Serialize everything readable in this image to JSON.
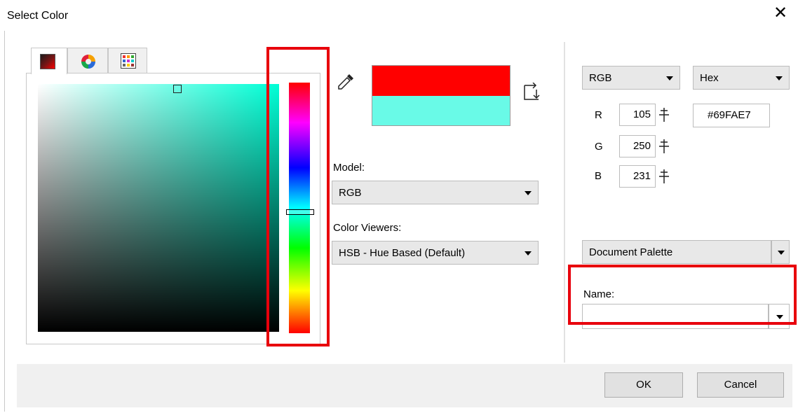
{
  "dialog": {
    "title": "Select Color",
    "close_glyph": "✕"
  },
  "tabs": [
    {
      "icon": "color-square-icon",
      "active": true
    },
    {
      "icon": "color-wheel-icon",
      "active": false
    },
    {
      "icon": "palette-grid-icon",
      "active": false
    }
  ],
  "picker": {
    "hue_color": "#00FFD6",
    "new_color": "#FF0000",
    "reference_color": "#69FAE7",
    "eyedropper_icon": "eyedropper-icon",
    "swap_icon": "swap-colors-icon"
  },
  "model": {
    "label": "Model:",
    "value": "RGB"
  },
  "viewers": {
    "label": "Color Viewers:",
    "value": "HSB - Hue Based (Default)"
  },
  "values": {
    "mode": "RGB",
    "format": "Hex",
    "hex": "#69FAE7",
    "channels": [
      {
        "label": "R",
        "value": "105"
      },
      {
        "label": "G",
        "value": "250"
      },
      {
        "label": "B",
        "value": "231"
      }
    ]
  },
  "palette": {
    "value": "Document Palette",
    "name_label": "Name:",
    "name_value": ""
  },
  "buttons": {
    "ok": "OK",
    "cancel": "Cancel"
  },
  "highlight_color": "#E8000C"
}
